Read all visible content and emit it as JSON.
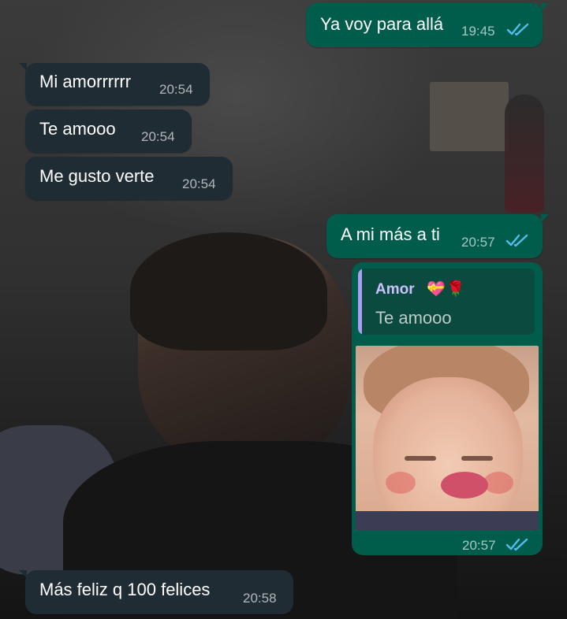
{
  "colors": {
    "incoming_bubble": "#1f2c34",
    "outgoing_bubble": "#005c4b",
    "read_ticks": "#53bdeb",
    "quote_accent": "#a89ef2"
  },
  "icons": {
    "read_receipt": "double-check-icon",
    "quote_emojis": [
      "heart-with-ribbon-icon",
      "rose-icon"
    ]
  },
  "messages": [
    {
      "direction": "out",
      "text": "Ya voy para allá",
      "time": "19:45",
      "status": "read"
    },
    {
      "direction": "in",
      "text": "Mi amorrrrrr",
      "time": "20:54"
    },
    {
      "direction": "in",
      "text": "Te amooo",
      "time": "20:54"
    },
    {
      "direction": "in",
      "text": "Me gusto verte",
      "time": "20:54"
    },
    {
      "direction": "out",
      "text": "A mi más a ti",
      "time": "20:57",
      "status": "read"
    },
    {
      "direction": "out",
      "reply_to": {
        "author": "Amor",
        "text": "Te amooo"
      },
      "media": "photo",
      "time": "20:57",
      "status": "read"
    },
    {
      "direction": "in",
      "text": "Más feliz q 100 felices",
      "time": "20:58"
    }
  ]
}
